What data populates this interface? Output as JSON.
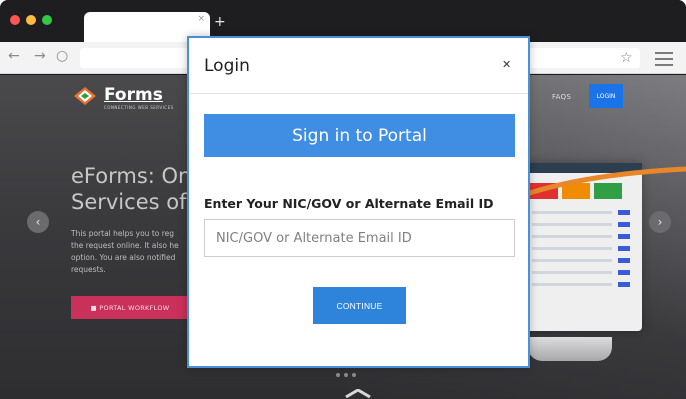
{
  "browser": {
    "tab_close": "×",
    "new_tab": "+",
    "back": "←",
    "forward": "→",
    "reload": "○",
    "bookmark": "☆"
  },
  "site": {
    "brand_name": "Forms",
    "brand_tagline": "CONNECTING WEB SERVICES",
    "nav_faqs": "FAQS",
    "nav_login": "LOGIN",
    "hero_title_line1": "eForms: Onl",
    "hero_title_line2": "Services of N",
    "hero_description": "This portal helps you to reg\nthe request online. It also he\noption. You are also notified\nrequests.",
    "workflow_button": "■ PORTAL WORKFLOW",
    "carousel_prev": "‹",
    "carousel_next": "›"
  },
  "modal": {
    "title": "Login",
    "close": "✕",
    "sign_in_button": "Sign in to Portal",
    "field_label": "Enter Your NIC/GOV or Alternate Email ID",
    "field_value": "",
    "field_placeholder": "NIC/GOV or Alternate Email ID",
    "continue_button": "CONTINUE"
  },
  "colors": {
    "accent_blue": "#3f8ee3",
    "continue_blue": "#2e84db",
    "workflow_pink": "#c9305a",
    "swoosh_orange": "#e8862a"
  },
  "icons": [
    "close-icon",
    "star-icon",
    "menu-icon",
    "back-icon",
    "forward-icon",
    "reload-icon",
    "chevron-left-icon",
    "chevron-right-icon",
    "chevron-down-icon"
  ]
}
